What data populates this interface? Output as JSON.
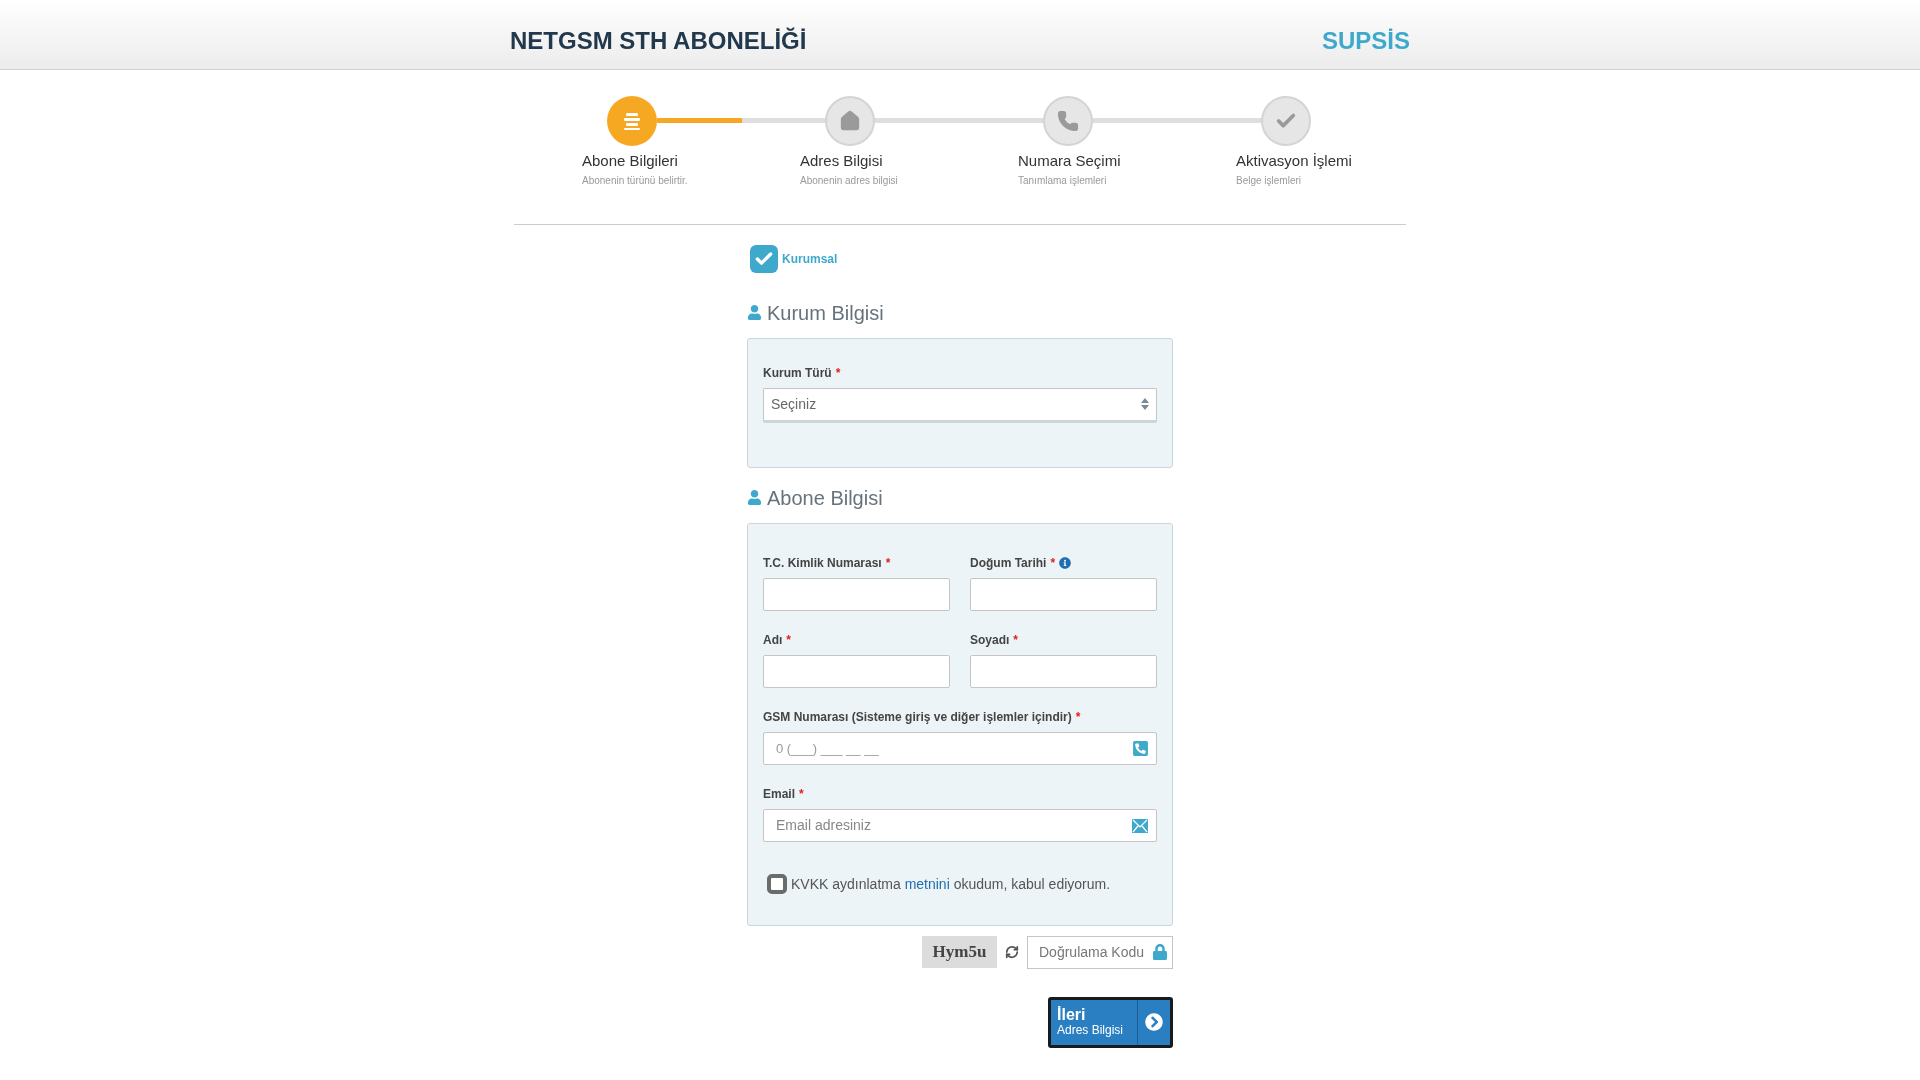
{
  "header": {
    "title": "NETGSM STH ABONELİĞİ",
    "brand": "SUPSİS"
  },
  "steps": {
    "progress": {
      "level": 0.14
    },
    "items": [
      {
        "title": "Abone Bilgileri",
        "subtitle": "Abonenin türünü belirtir.",
        "selected": true
      },
      {
        "title": "Adres Bilgisi",
        "subtitle": "Abonenin adres bilgisi",
        "selected": false
      },
      {
        "title": "Numara Seçimi",
        "subtitle": "Tanımlama işlemleri",
        "selected": false
      },
      {
        "title": "Aktivasyon İşlemi",
        "subtitle": "Belge işlemleri",
        "selected": false
      }
    ]
  },
  "type_option": {
    "label": "Kurumsal",
    "checked": true
  },
  "kurum_section": {
    "heading": "Kurum Bilgisi",
    "field": {
      "label": "Kurum Türü",
      "required": "*",
      "value": "Seçiniz"
    }
  },
  "abone_section": {
    "heading": "Abone Bilgisi",
    "fields": [
      {
        "label": "T.C. Kimlik Numarası",
        "required": "*"
      },
      {
        "label": "Doğum Tarihi",
        "required": "*",
        "info": true
      },
      {
        "label": "Adı",
        "required": "*"
      },
      {
        "label": "Soyadı",
        "required": "*"
      }
    ],
    "gsm": {
      "label": "GSM Numarası (Sisteme giriş ve diğer işlemler içindir)",
      "required": "*",
      "placeholder": "0 (___) ___ __ __"
    },
    "email": {
      "label": "Email",
      "required": "*",
      "placeholder": "Email adresiniz"
    },
    "consent": {
      "checked": false,
      "before": "KVKK aydınlatma",
      "link": "metnini",
      "after": "okudum, kabul ediyorum."
    }
  },
  "captcha": {
    "code": "Hym5u",
    "placeholder": "Doğrulama Kodu"
  },
  "next_button": {
    "label": "İleri",
    "sublabel": "Adres Bilgisi"
  }
}
